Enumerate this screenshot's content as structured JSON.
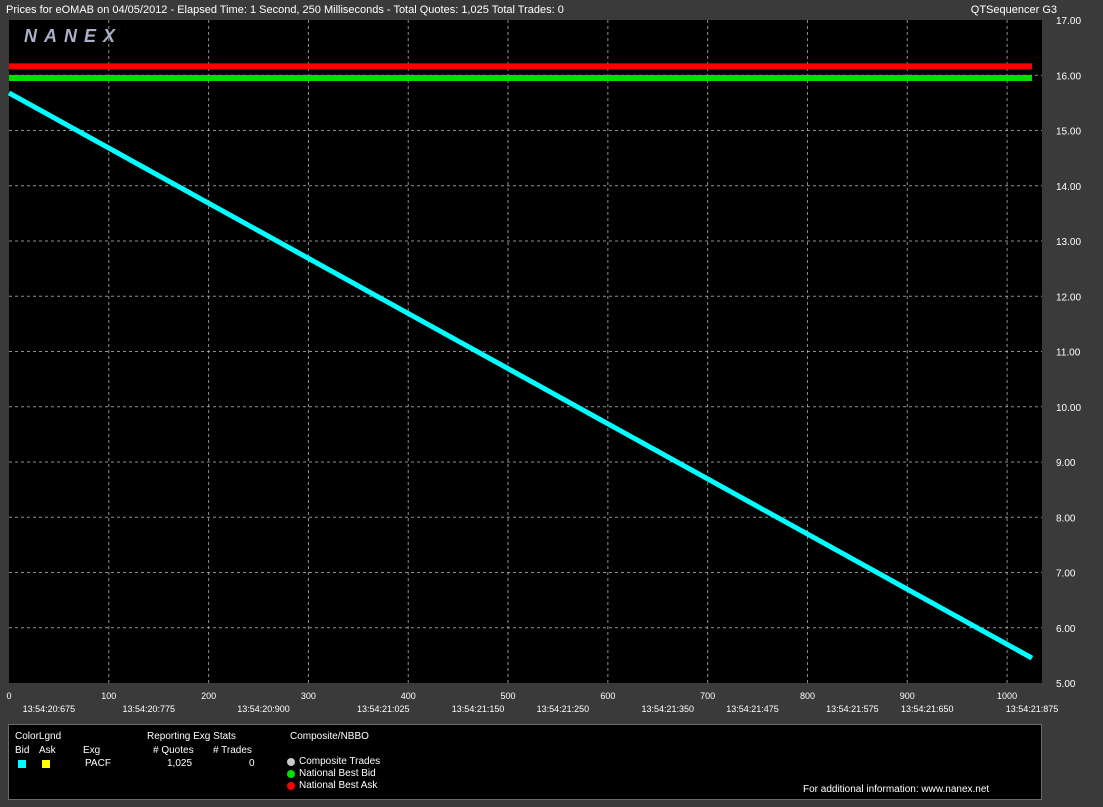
{
  "header": {
    "title": "Prices for  eOMAB  on  04/05/2012  -  Elapsed Time: 1 Second, 250 Milliseconds  -  Total Quotes: 1,025  Total Trades: 0",
    "app_name": "QTSequencer G3"
  },
  "logo_text": "NANEX",
  "colors": {
    "background": "#3a3a3a",
    "plot_background": "#000000",
    "grid": "#bfbfbf",
    "bid": "#00ffff",
    "ask": "#ffff00",
    "national_best_bid": "#00e000",
    "national_best_ask": "#ff0000",
    "composite_trades": "#c8c8c8"
  },
  "chart_data": {
    "type": "line",
    "x_label_rows": {
      "sequence_ticks": [
        0,
        100,
        200,
        300,
        400,
        500,
        600,
        700,
        800,
        900,
        1000
      ],
      "time_ticks": [
        {
          "seq": 40,
          "label": "13:54:20:675"
        },
        {
          "seq": 140,
          "label": "13:54:20:775"
        },
        {
          "seq": 255,
          "label": "13:54:20:900"
        },
        {
          "seq": 375,
          "label": "13:54:21:025"
        },
        {
          "seq": 470,
          "label": "13:54:21:150"
        },
        {
          "seq": 555,
          "label": "13:54:21:250"
        },
        {
          "seq": 660,
          "label": "13:54:21:350"
        },
        {
          "seq": 745,
          "label": "13:54:21:475"
        },
        {
          "seq": 845,
          "label": "13:54:21:575"
        },
        {
          "seq": 920,
          "label": "13:54:21:650"
        },
        {
          "seq": 1025,
          "label": "13:54:21:875"
        }
      ]
    },
    "xlim": [
      0,
      1035
    ],
    "ylim": [
      5.0,
      17.0
    ],
    "y_ticks": [
      "5.00",
      "6.00",
      "7.00",
      "8.00",
      "9.00",
      "10.00",
      "11.00",
      "12.00",
      "13.00",
      "14.00",
      "15.00",
      "16.00",
      "17.00"
    ],
    "grid": true,
    "series": [
      {
        "name": "National Best Ask",
        "color": "#ff0000",
        "x": [
          0,
          1025
        ],
        "y": [
          16.16,
          16.16
        ]
      },
      {
        "name": "National Best Bid",
        "color": "#00e000",
        "x": [
          0,
          1025
        ],
        "y": [
          15.95,
          15.95
        ]
      },
      {
        "name": "Bid",
        "color": "#00ffff",
        "x": [
          0,
          1025
        ],
        "y": [
          15.68,
          5.45
        ]
      }
    ]
  },
  "legend": {
    "color_legend_title": "ColorLgnd",
    "bid_label": "Bid",
    "ask_label": "Ask",
    "exg_header": "Exg",
    "exchange": "PACF",
    "stats_title": "Reporting Exg Stats",
    "quotes_header": "# Quotes",
    "trades_header": "# Trades",
    "quotes_value": "1,025",
    "trades_value": "0",
    "composite_title": "Composite/NBBO",
    "composite_trades": "Composite Trades",
    "national_best_bid": "National Best Bid",
    "national_best_ask": "National Best Ask",
    "footer": "For additional information: www.nanex.net"
  }
}
